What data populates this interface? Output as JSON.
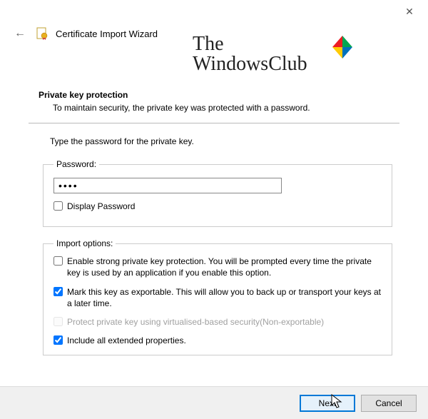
{
  "window": {
    "close_symbol": "✕"
  },
  "header": {
    "back_symbol": "←",
    "title": "Certificate Import Wizard"
  },
  "watermark": {
    "line1": "The",
    "line2": "WindowsClub"
  },
  "page": {
    "heading": "Private key protection",
    "subheading": "To maintain security, the private key was protected with a password.",
    "instruction": "Type the password for the private key."
  },
  "password": {
    "legend": "Password:",
    "value": "••••",
    "display_label": "Display Password",
    "display_checked": false
  },
  "import_options": {
    "legend": "Import options:",
    "opt1": {
      "label": "Enable strong private key protection. You will be prompted every time the private key is used by an application if you enable this option.",
      "checked": false,
      "disabled": false
    },
    "opt2": {
      "label": "Mark this key as exportable. This will allow you to back up or transport your keys at a later time.",
      "checked": true,
      "disabled": false
    },
    "opt3": {
      "label": "Protect private key using virtualised-based security(Non-exportable)",
      "checked": false,
      "disabled": true
    },
    "opt4": {
      "label": "Include all extended properties.",
      "checked": true,
      "disabled": false
    }
  },
  "buttons": {
    "next": "Next",
    "cancel": "Cancel"
  }
}
